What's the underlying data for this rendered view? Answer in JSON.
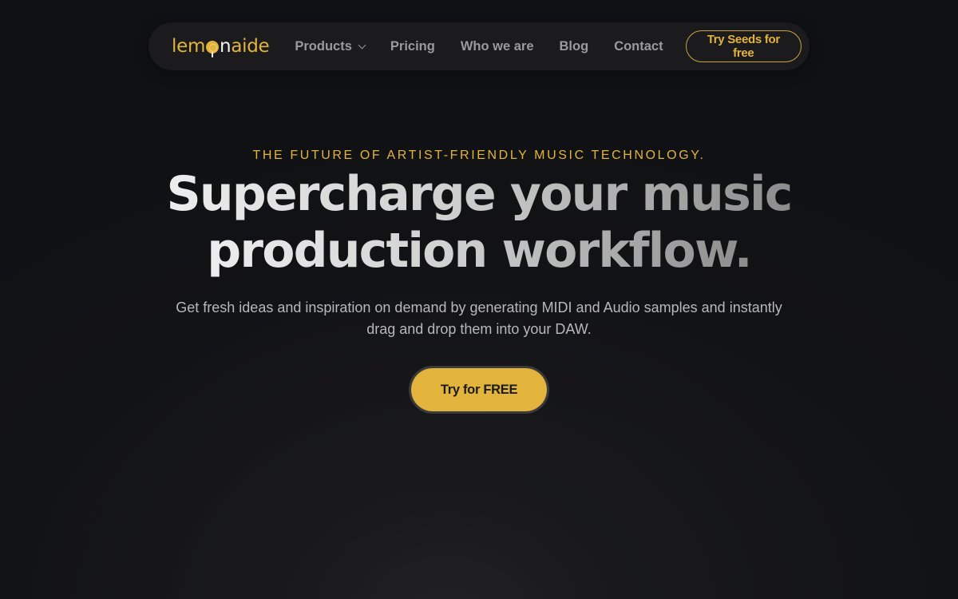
{
  "colors": {
    "background": "#101114",
    "nav_background": "#1b1b1e",
    "accent_gold": "#e2b43c",
    "nav_text": "#9a9a9d"
  },
  "nav": {
    "logo": {
      "part1": "lem",
      "lemon_icon": "lemon-icon",
      "part2": "n",
      "part3": "aide",
      "full": "lemonaide"
    },
    "links": [
      {
        "label": "Products",
        "has_dropdown": true
      },
      {
        "label": "Pricing"
      },
      {
        "label": "Who we are"
      },
      {
        "label": "Blog"
      },
      {
        "label": "Contact"
      }
    ],
    "cta_label": "Try Seeds for free"
  },
  "hero": {
    "eyebrow": "THE FUTURE OF ARTIST-FRIENDLY MUSIC TECHNOLOGY.",
    "headline_line1": "Supercharge your music",
    "headline_line2": "production workflow.",
    "subtitle": "Get fresh ideas and inspiration on demand by generating MIDI and Audio samples and instantly drag and drop them into your DAW.",
    "cta_label": "Try for FREE"
  }
}
